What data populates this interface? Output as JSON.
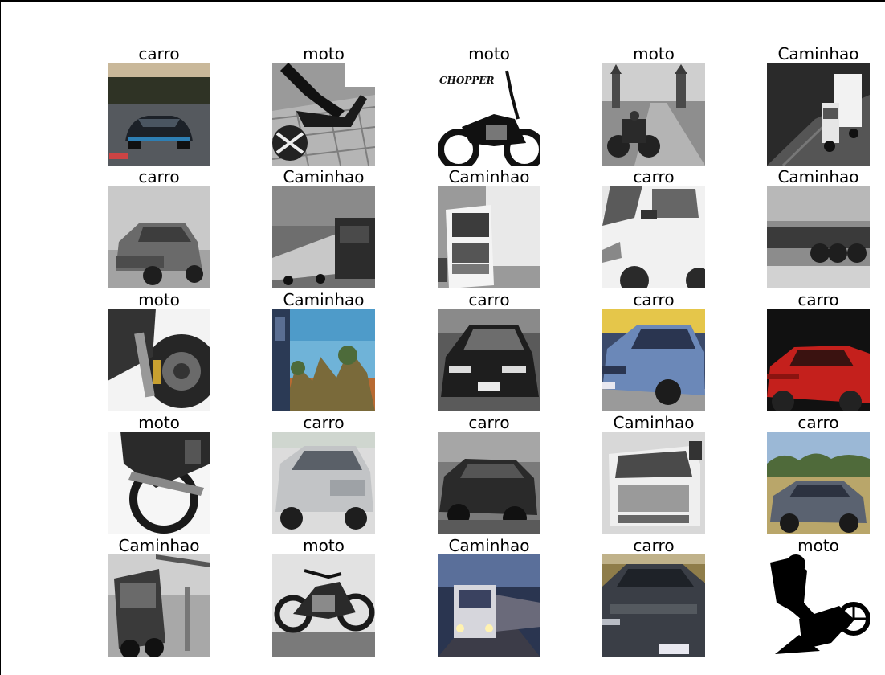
{
  "figure": {
    "labels": [
      [
        "carro",
        "moto",
        "moto",
        "moto",
        "Caminhao"
      ],
      [
        "carro",
        "Caminhao",
        "Caminhao",
        "carro",
        "Caminhao"
      ],
      [
        "moto",
        "Caminhao",
        "carro",
        "carro",
        "carro"
      ],
      [
        "moto",
        "carro",
        "carro",
        "Caminhao",
        "carro"
      ],
      [
        "Caminhao",
        "moto",
        "Caminhao",
        "carro",
        "moto"
      ]
    ],
    "images": [
      [
        "car-photo",
        "motorcycle-photo",
        "motorcycle-photo",
        "motorcycle-photo",
        "truck-photo"
      ],
      [
        "car-photo",
        "truck-photo",
        "truck-photo",
        "car-photo",
        "truck-photo"
      ],
      [
        "motorcycle-photo",
        "truck-photo",
        "car-photo",
        "car-photo",
        "car-photo"
      ],
      [
        "motorcycle-photo",
        "car-photo",
        "car-photo",
        "truck-photo",
        "car-photo"
      ],
      [
        "truck-photo",
        "motorcycle-photo",
        "truck-photo",
        "car-photo",
        "motorcycle-silhouette"
      ]
    ]
  }
}
